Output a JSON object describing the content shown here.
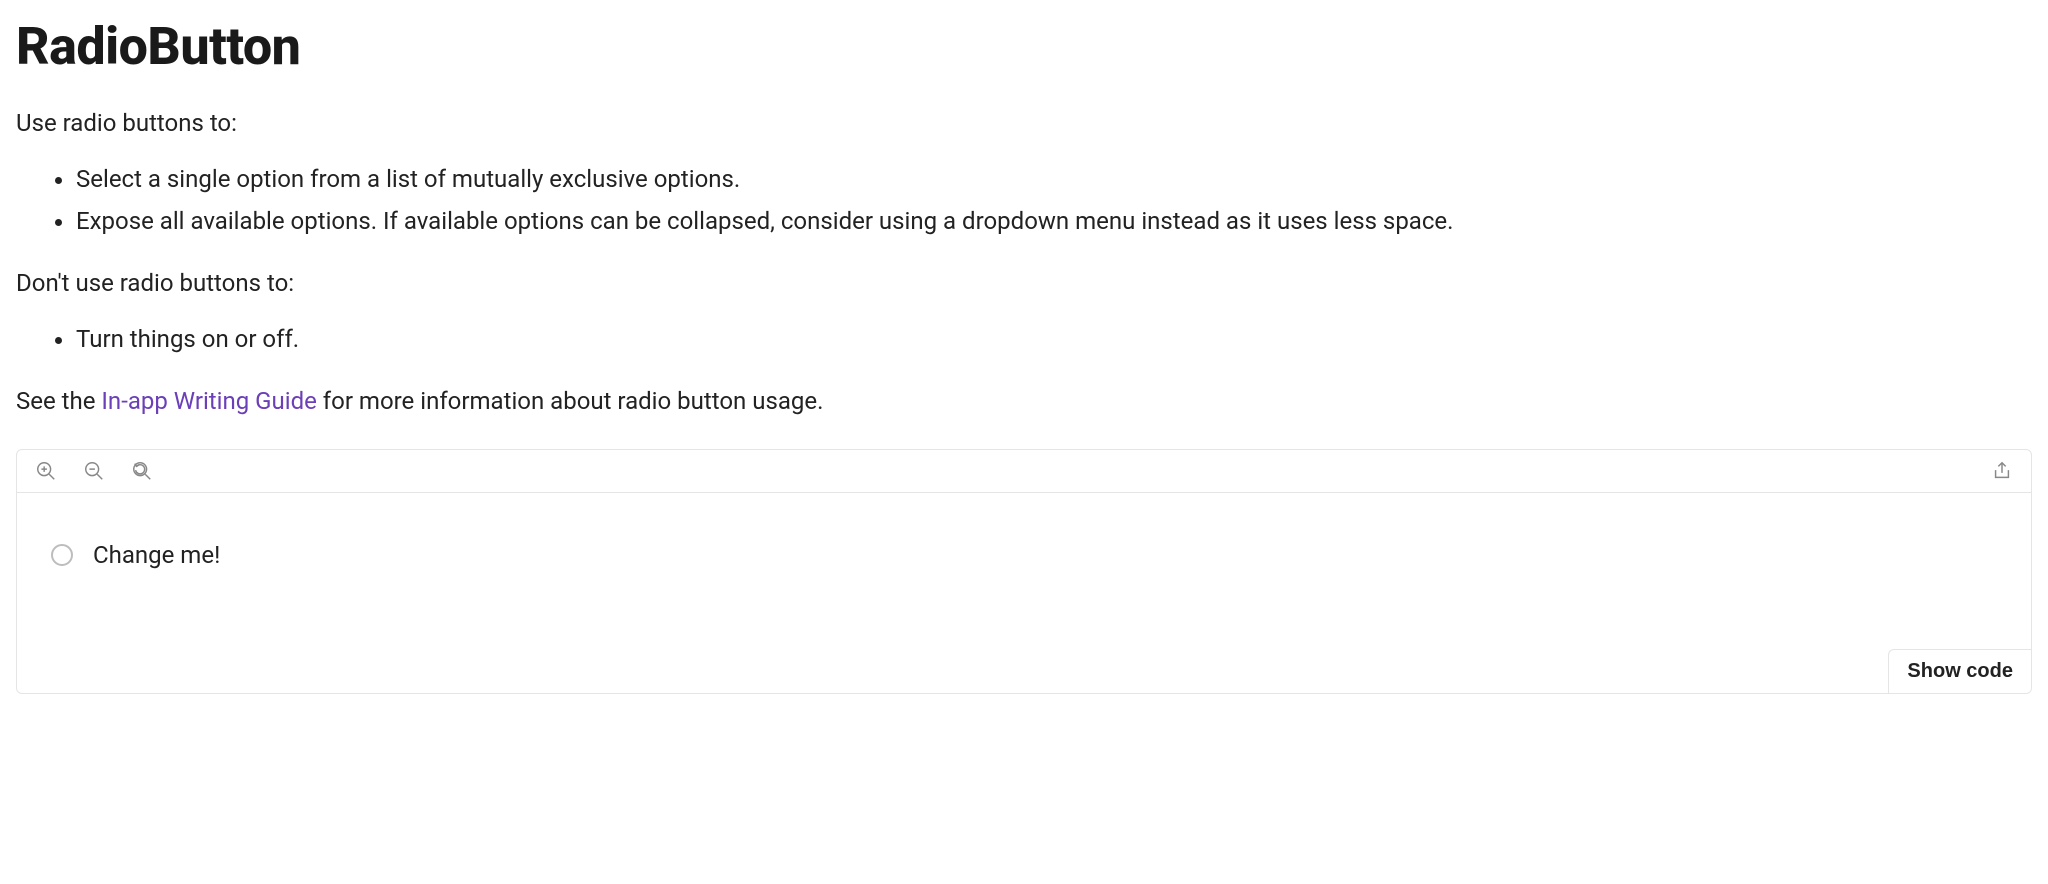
{
  "title": "RadioButton",
  "intro1": "Use radio buttons to:",
  "use_list": [
    "Select a single option from a list of mutually exclusive options.",
    "Expose all available options. If available options can be collapsed, consider using a dropdown menu instead as it uses less space."
  ],
  "intro2": "Don't use radio buttons to:",
  "dont_list": [
    "Turn things on or off."
  ],
  "see_prefix": "See the ",
  "see_link": "In-app Writing Guide",
  "see_suffix": " for more information about radio button usage.",
  "example": {
    "radio_label": "Change me!",
    "show_code_label": "Show code"
  }
}
